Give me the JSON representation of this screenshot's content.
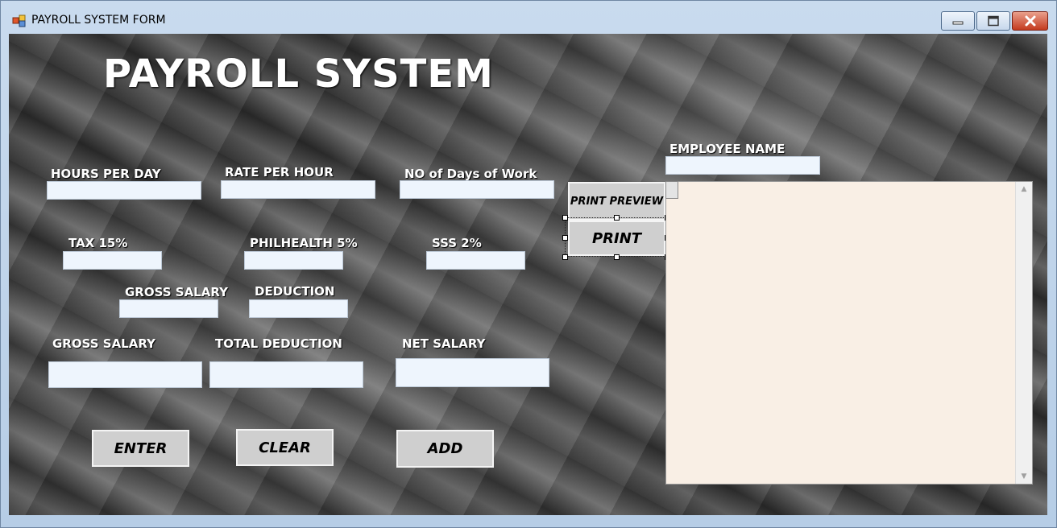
{
  "window": {
    "title": "PAYROLL SYSTEM FORM"
  },
  "header": {
    "title": "PAYROLL SYSTEM"
  },
  "fields": {
    "hours_per_day": {
      "label": "HOURS PER DAY",
      "value": ""
    },
    "rate_per_hour": {
      "label": "RATE PER HOUR",
      "value": ""
    },
    "days_of_work": {
      "label": "NO of Days of Work",
      "value": ""
    },
    "tax": {
      "label": "TAX 15%",
      "value": ""
    },
    "philhealth": {
      "label": "PHILHEALTH 5%",
      "value": ""
    },
    "sss": {
      "label": "SSS 2%",
      "value": ""
    },
    "gross_salary_small": {
      "label": "GROSS SALARY",
      "value": ""
    },
    "deduction": {
      "label": "DEDUCTION",
      "value": ""
    },
    "gross_salary": {
      "label": "GROSS SALARY",
      "value": ""
    },
    "total_deduction": {
      "label": "TOTAL DEDUCTION",
      "value": ""
    },
    "net_salary": {
      "label": "NET SALARY",
      "value": ""
    },
    "employee_name": {
      "label": "EMPLOYEE NAME",
      "value": ""
    }
  },
  "buttons": {
    "print_preview": "PRINT PREVIEW",
    "print": "PRINT",
    "enter": "ENTER",
    "clear": "CLEAR",
    "add": "ADD"
  },
  "receipt": {
    "text": ""
  },
  "icons": {
    "minimize": "minimize-icon",
    "maximize": "maximize-icon",
    "close": "close-icon",
    "app": "app-icon",
    "scroll_up": "scroll-up-arrow-icon",
    "scroll_down": "scroll-down-arrow-icon"
  },
  "colors": {
    "field_bg": "#eef5fd",
    "button_bg": "#cfcfcf",
    "receipt_bg": "#f9efe5",
    "close_button": "#c43b1f"
  }
}
